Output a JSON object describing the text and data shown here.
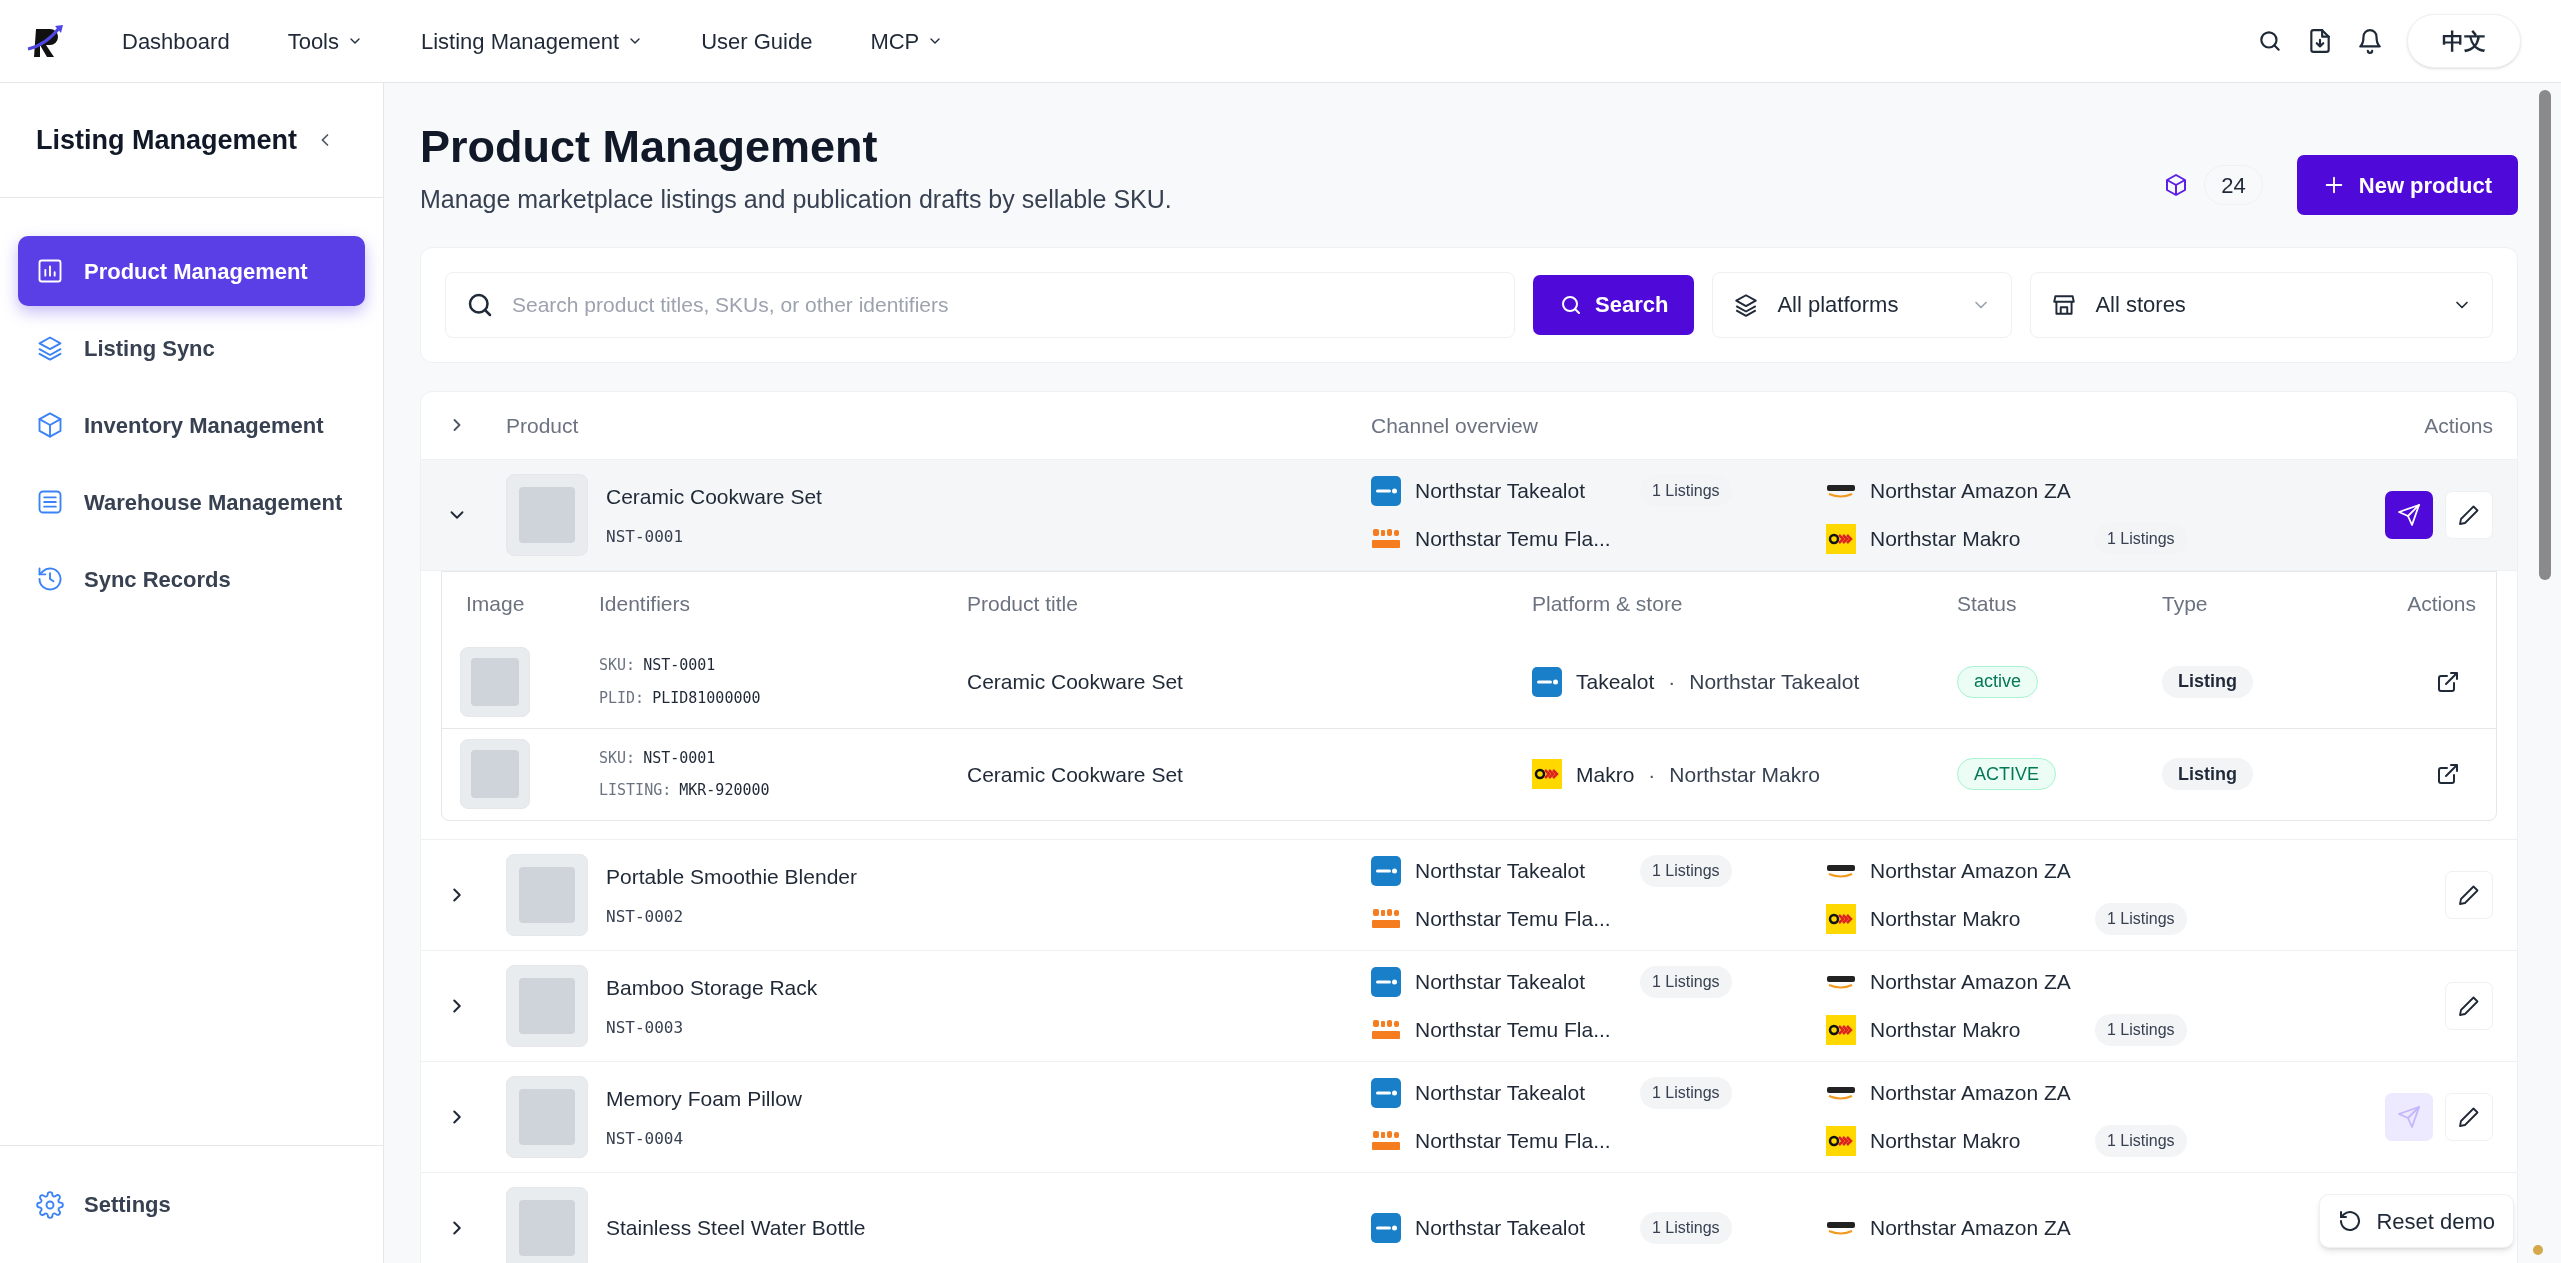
{
  "top_nav": {
    "items": [
      {
        "label": "Dashboard",
        "has_menu": false
      },
      {
        "label": "Tools",
        "has_menu": true
      },
      {
        "label": "Listing Management",
        "has_menu": true
      },
      {
        "label": "User Guide",
        "has_menu": false
      },
      {
        "label": "MCP",
        "has_menu": true
      }
    ],
    "language_button": "中文"
  },
  "sidebar": {
    "title": "Listing Management",
    "items": [
      {
        "label": "Product Management",
        "kind": "chart",
        "selected": true
      },
      {
        "label": "Listing Sync",
        "kind": "layers",
        "selected": false
      },
      {
        "label": "Inventory Management",
        "kind": "box",
        "selected": false
      },
      {
        "label": "Warehouse Management",
        "kind": "warehouse",
        "selected": false
      },
      {
        "label": "Sync Records",
        "kind": "history",
        "selected": false
      }
    ],
    "footer_item": "Settings"
  },
  "page": {
    "title": "Product Management",
    "subtitle": "Manage marketplace listings and publication drafts by sellable SKU.",
    "product_count": "24",
    "new_button": "New product"
  },
  "filters": {
    "search": {
      "placeholder": "Search product titles, SKUs, or other identifiers"
    },
    "search_button": "Search",
    "platform_select": "All platforms",
    "store_select": "All stores"
  },
  "table": {
    "columns": [
      "Product",
      "Channel overview",
      "Actions"
    ],
    "rows": [
      {
        "name": "Ceramic Cookware Set",
        "sku": "NST-0001",
        "expanded": true,
        "edit_button": true,
        "publish": {
          "disabled": false
        },
        "channels": [
          {
            "kind": "takealot",
            "name": "Northstar Takealot",
            "count": "1 Listings"
          },
          {
            "kind": "amazon",
            "name": "Northstar Amazon ZA"
          },
          {
            "kind": "temu",
            "name": "Northstar Temu Fla..."
          },
          {
            "kind": "makro",
            "name": "Northstar Makro",
            "count": "1 Listings"
          }
        ],
        "detail": {
          "columns": [
            "Image",
            "Identifiers",
            "Product title",
            "Platform & store",
            "Status",
            "Type",
            "Actions"
          ],
          "rows": [
            {
              "identifiers": [
                {
                  "label": "SKU:",
                  "value": "NST-0001"
                },
                {
                  "label": "PLID:",
                  "value": "PLID81000000"
                }
              ],
              "title": "Ceramic Cookware Set",
              "kind": "takealot",
              "platform": "Takealot",
              "separator": "·",
              "store": "Northstar Takealot",
              "status": "active",
              "type": "Listing"
            },
            {
              "identifiers": [
                {
                  "label": "SKU:",
                  "value": "NST-0001"
                },
                {
                  "label": "LISTING:",
                  "value": "MKR-920000"
                }
              ],
              "title": "Ceramic Cookware Set",
              "kind": "makro",
              "platform": "Makro",
              "separator": "·",
              "store": "Northstar Makro",
              "status": "ACTIVE",
              "type": "Listing"
            }
          ]
        }
      },
      {
        "name": "Portable Smoothie Blender",
        "sku": "NST-0002",
        "expanded": false,
        "edit_button": true,
        "channels": [
          {
            "kind": "takealot",
            "name": "Northstar Takealot",
            "count": "1 Listings"
          },
          {
            "kind": "amazon",
            "name": "Northstar Amazon ZA"
          },
          {
            "kind": "temu",
            "name": "Northstar Temu Fla..."
          },
          {
            "kind": "makro",
            "name": "Northstar Makro",
            "count": "1 Listings"
          }
        ]
      },
      {
        "name": "Bamboo Storage Rack",
        "sku": "NST-0003",
        "expanded": false,
        "edit_button": true,
        "channels": [
          {
            "kind": "takealot",
            "name": "Northstar Takealot",
            "count": "1 Listings"
          },
          {
            "kind": "amazon",
            "name": "Northstar Amazon ZA"
          },
          {
            "kind": "temu",
            "name": "Northstar Temu Fla..."
          },
          {
            "kind": "makro",
            "name": "Northstar Makro",
            "count": "1 Listings"
          }
        ]
      },
      {
        "name": "Memory Foam Pillow",
        "sku": "NST-0004",
        "expanded": false,
        "edit_button": true,
        "publish": {
          "disabled": true
        },
        "channels": [
          {
            "kind": "takealot",
            "name": "Northstar Takealot",
            "count": "1 Listings"
          },
          {
            "kind": "amazon",
            "name": "Northstar Amazon ZA"
          },
          {
            "kind": "temu",
            "name": "Northstar Temu Fla..."
          },
          {
            "kind": "makro",
            "name": "Northstar Makro",
            "count": "1 Listings"
          }
        ]
      },
      {
        "name": "Stainless Steel Water Bottle",
        "expanded": false,
        "edit_button": false,
        "channels": [
          {
            "kind": "takealot",
            "name": "Northstar Takealot",
            "count": "1 Listings"
          },
          {
            "kind": "amazon",
            "name": "Northstar Amazon ZA"
          }
        ]
      }
    ]
  },
  "reset_button": "Reset demo"
}
